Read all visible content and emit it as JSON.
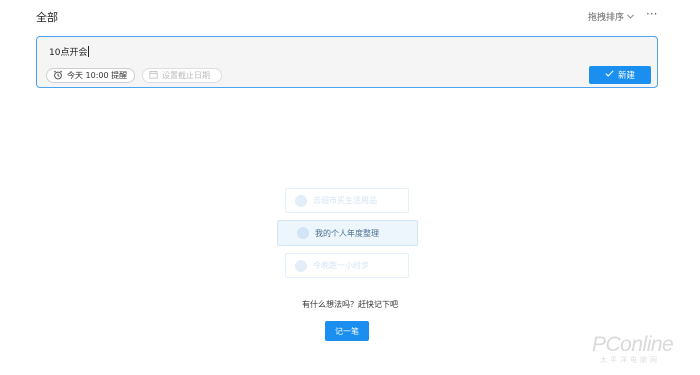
{
  "header": {
    "title": "全部",
    "sort_label": "拖拽排序",
    "sort_icon": "chevron-down-icon",
    "more_icon": "more-icon",
    "more_glyph": "···"
  },
  "task_input": {
    "value": "10点开会",
    "reminder_chip": {
      "icon": "alarm-clock-icon",
      "label": "今天 10:00 提醒"
    },
    "deadline_chip": {
      "icon": "calendar-icon",
      "label": "设置截止日期"
    },
    "create_button": {
      "icon": "check-icon",
      "label": "新建"
    }
  },
  "suggestions": [
    {
      "label": "去超市买生活用品"
    },
    {
      "label": "我的个人年度整理"
    },
    {
      "label": "今晚跑一小时步"
    }
  ],
  "empty_state": {
    "hint": "有什么想法吗？赶快记下吧",
    "button_label": "记一笔"
  },
  "watermark": {
    "main": "PConline",
    "sub": "太平洋电脑网"
  },
  "colors": {
    "accent": "#1a8ff0",
    "input_border": "#4da3ee",
    "input_bg": "#f5f5f5"
  }
}
